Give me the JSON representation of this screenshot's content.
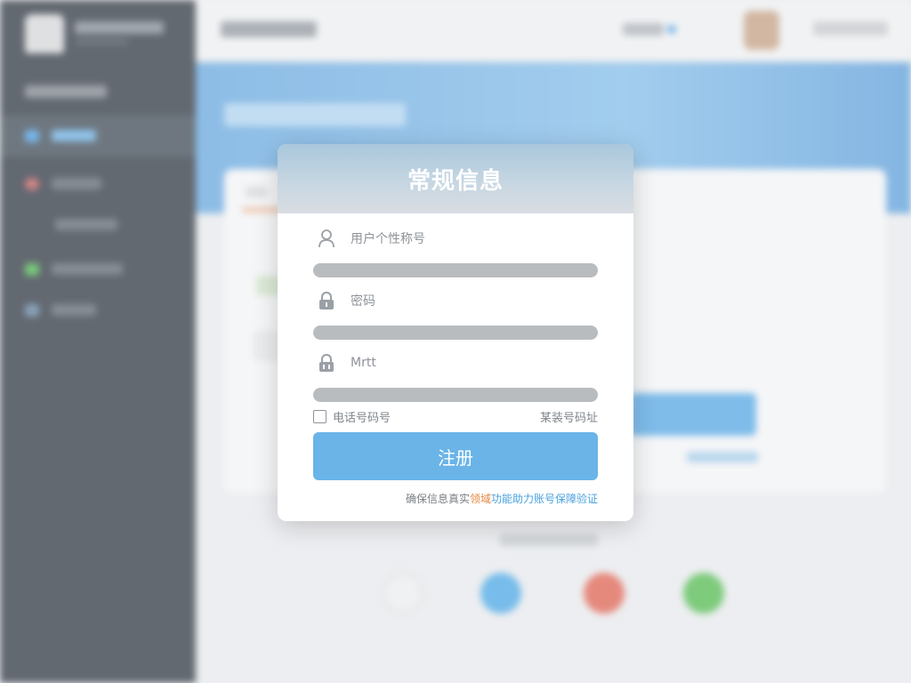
{
  "modal": {
    "title": "常规信息",
    "fields": [
      {
        "icon": "user-icon",
        "label": "用户个性称号"
      },
      {
        "icon": "lock-icon",
        "label": "密码"
      },
      {
        "icon": "lock-icon",
        "label": "Mrtt"
      }
    ],
    "remember_label": "电话号码号",
    "link_label": "某装号码址",
    "register_label": "注册",
    "footnote": {
      "prefix": "确保信息真实",
      "highlight": "领域",
      "suffix": "功能助力账号保障验证"
    }
  },
  "colors": {
    "accent": "#6ab4e8",
    "sidebar": "#414852",
    "banner": "#74aee0",
    "footnote_highlight": "#e7873f",
    "footnote_link": "#4aa1de"
  }
}
